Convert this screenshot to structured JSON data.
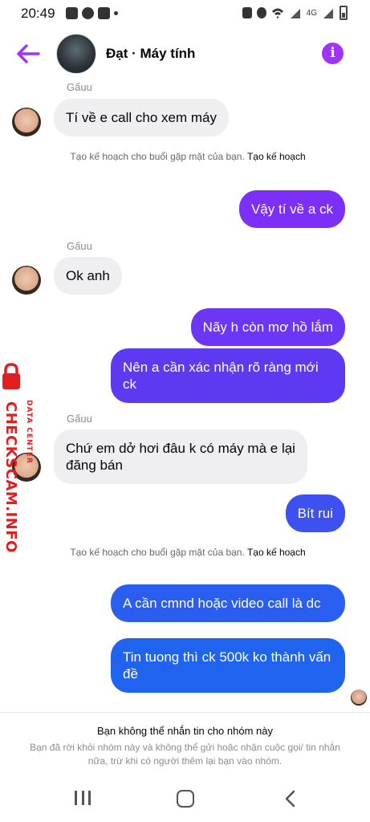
{
  "status_bar": {
    "time": "20:49",
    "network": "4G"
  },
  "header": {
    "title": "Đạt · Máy tính"
  },
  "colors": {
    "accent": "#a033ff",
    "bubble_in": "#efeff1"
  },
  "messages": [
    {
      "type": "sender",
      "text": "Gấuu"
    },
    {
      "type": "in",
      "text": "Tí về e call cho xem máy"
    },
    {
      "type": "system",
      "text": "Tạo kế hoạch cho buổi gặp mặt của bạn.",
      "link": "Tạo kế hoạch"
    },
    {
      "type": "out",
      "text": "Vậy tí về a ck",
      "color": "#7b2ff7"
    },
    {
      "type": "sender",
      "text": "Gấuu"
    },
    {
      "type": "in",
      "text": "Ok anh"
    },
    {
      "type": "out",
      "text": "Nãy h còn mơ hồ lắm",
      "color": "#6b36f5"
    },
    {
      "type": "out",
      "text": "Nên a cần xác nhận rõ ràng mới ck",
      "color": "#5d3af2"
    },
    {
      "type": "sender",
      "text": "Gấuu"
    },
    {
      "type": "in",
      "text": "Chứ em dở hơi đâu k có máy mà e lại đăng bán"
    },
    {
      "type": "out",
      "text": "Bít rui",
      "color": "#3d50f0"
    },
    {
      "type": "system",
      "text": "Tạo kế hoạch cho buổi gặp mặt của bạn.",
      "link": "Tạo kế hoạch"
    },
    {
      "type": "out",
      "text": "A cần cmnd hoặc video call là dc",
      "color": "#2a5ef0"
    },
    {
      "type": "out",
      "text": "Tin tuong thì ck 500k ko thành vấn đề",
      "color": "#1f63ef"
    }
  ],
  "footer": {
    "title": "Bạn không thể nhắn tin cho nhóm này",
    "description": "Bạn đã rời khỏi nhóm này và không thể gửi hoặc nhận cuộc gọi/ tin nhắn nữa, trừ khi có người thêm lại bạn vào nhóm."
  },
  "watermark": {
    "main": "CHECKSCAM.INFO",
    "sub": "DATA CENTER"
  }
}
